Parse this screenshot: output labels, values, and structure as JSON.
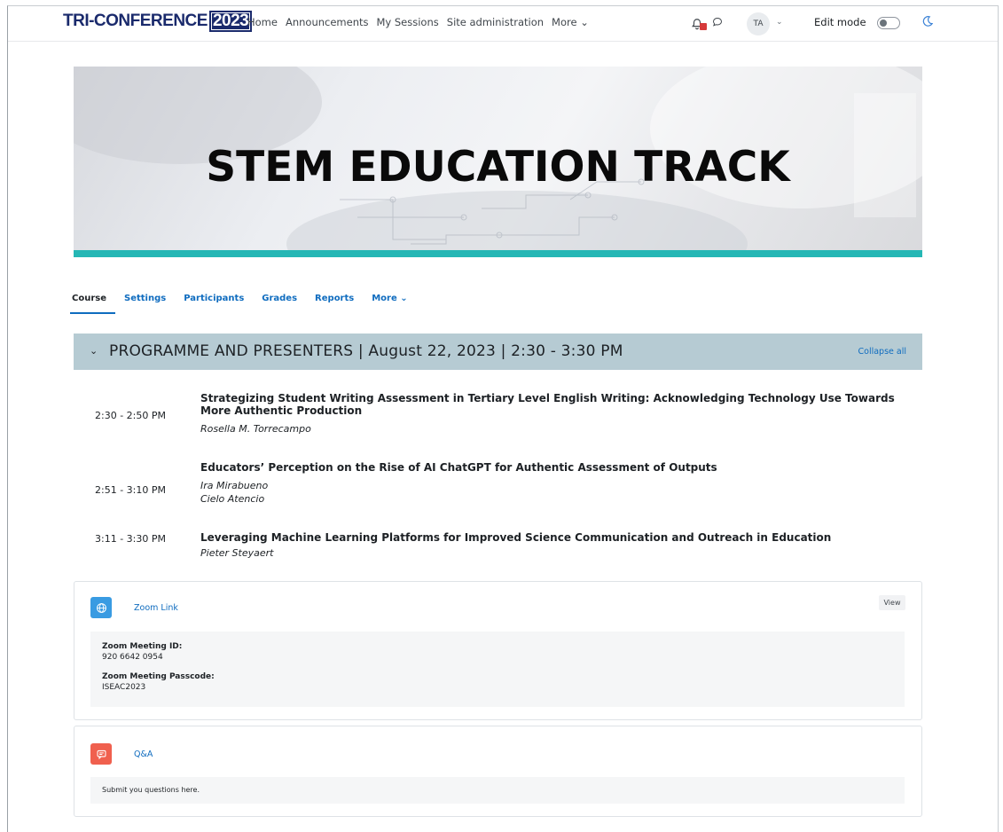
{
  "header": {
    "logo_text": "TRI-CONFERENCE",
    "logo_year": "2023",
    "nav": [
      "Home",
      "Announcements",
      "My Sessions",
      "Site administration",
      "More ⌄"
    ],
    "avatar_initials": "TA",
    "edit_mode_label": "Edit mode",
    "edit_mode_on": false
  },
  "banner": {
    "title": "STEM EDUCATION TRACK",
    "accent_color": "#25b7b5"
  },
  "course_tabs": [
    "Course",
    "Settings",
    "Participants",
    "Grades",
    "Reports",
    "More ⌄"
  ],
  "active_tab": "Course",
  "section": {
    "title": "PROGRAMME AND PRESENTERS | August 22, 2023 | 2:30 - 3:30 PM",
    "collapse_label": "Collapse all",
    "header_color": "#b6cbd3"
  },
  "sessions": [
    {
      "time": "2:30 - 2:50 PM",
      "title": "Strategizing Student Writing Assessment in Tertiary Level English Writing: Acknowledging Technology Use Towards More Authentic Production",
      "presenters": [
        "Rosella M. Torrecampo"
      ]
    },
    {
      "time": "2:51 - 3:10 PM",
      "title": "Educators’ Perception on the Rise of AI ChatGPT for Authentic Assessment of Outputs",
      "presenters": [
        "Ira Mirabueno",
        "Cielo Atencio"
      ]
    },
    {
      "time": "3:11 - 3:30 PM",
      "title": "Leveraging Machine Learning Platforms for Improved Science Communication and Outreach in Education",
      "presenters": [
        "Pieter Steyaert"
      ]
    }
  ],
  "activities": {
    "zoom": {
      "name": "Zoom Link",
      "icon": "globe-icon",
      "icon_color": "#399be2",
      "view_label": "View",
      "meeting_id_label": "Zoom Meeting ID:",
      "meeting_id": "920 6642 0954",
      "passcode_label": "Zoom Meeting Passcode:",
      "passcode": "ISEAC2023"
    },
    "qa": {
      "name": "Q&A",
      "icon": "forum-icon",
      "icon_color": "#f0604e",
      "description": "Submit you questions here."
    }
  }
}
